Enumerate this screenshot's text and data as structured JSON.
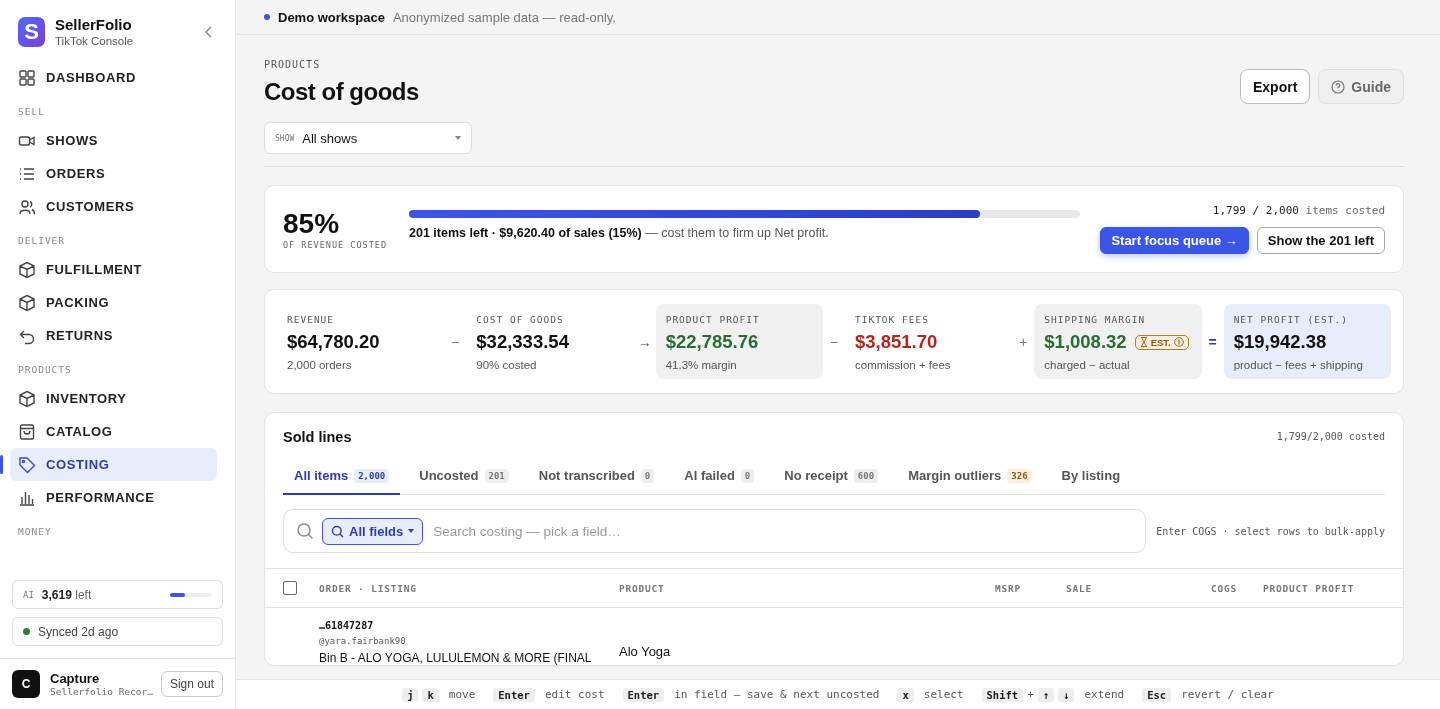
{
  "brand": {
    "name": "SellerFolio",
    "subtitle": "TikTok Console",
    "initial": "S"
  },
  "nav": [
    {
      "items": [
        {
          "label": "DASHBOARD",
          "selected": false
        }
      ]
    },
    {
      "heading": "SELL",
      "items": [
        {
          "label": "SHOWS",
          "selected": false
        },
        {
          "label": "ORDERS",
          "selected": false
        },
        {
          "label": "CUSTOMERS",
          "selected": false
        }
      ]
    },
    {
      "heading": "DELIVER",
      "items": [
        {
          "label": "FULFILLMENT",
          "selected": false
        },
        {
          "label": "PACKING",
          "selected": false
        },
        {
          "label": "RETURNS",
          "selected": false
        }
      ]
    },
    {
      "heading": "PRODUCTS",
      "items": [
        {
          "label": "INVENTORY",
          "selected": false
        },
        {
          "label": "CATALOG",
          "selected": false
        },
        {
          "label": "COSTING",
          "selected": true
        },
        {
          "label": "PERFORMANCE",
          "selected": false
        }
      ]
    },
    {
      "heading": "MONEY"
    }
  ],
  "ai_credits": {
    "prefix": "AI",
    "count": "3,619",
    "suffix": "left",
    "level": 0.35
  },
  "sync": {
    "label": "Synced 2d ago",
    "color": "#2e7d32"
  },
  "user": {
    "initial": "C",
    "name": "Capture",
    "detail": "Sellerfolio Recor…",
    "sign_out": "Sign out"
  },
  "banner": {
    "title": "Demo workspace",
    "note": "Anonymized sample data — read-only."
  },
  "page": {
    "eyebrow": "PRODUCTS",
    "title": "Cost of goods",
    "actions": [
      {
        "label": "Export",
        "kind": "primary"
      },
      {
        "label": "Guide",
        "kind": "help"
      }
    ],
    "filter": {
      "label": "SHOW",
      "value": "All shows"
    }
  },
  "coverage": {
    "percent": "85%",
    "caption": "OF REVENUE COSTED",
    "level": 0.85,
    "summary_bold": "201 items left · $9,620.40 of sales (15%)",
    "summary_rest": "— cost them to firm up Net profit.",
    "count": "1,799 / 2,000",
    "count_suffix": "items costed",
    "buttons": [
      {
        "label": "Start focus queue →",
        "kind": "primary"
      },
      {
        "label": "Show the 201 left",
        "kind": "secondary"
      }
    ]
  },
  "metrics": [
    {
      "label": "REVENUE",
      "value": "$64,780.20",
      "sub": "2,000 orders",
      "color": "#111111",
      "kind": "plain",
      "operator": "−"
    },
    {
      "label": "COST OF GOODS",
      "value": "$32,333.54",
      "sub": "90% costed",
      "color": "#111111",
      "kind": "plain",
      "operator": "→"
    },
    {
      "label": "PRODUCT PROFIT",
      "value": "$22,785.76",
      "sub": "41.3% margin",
      "color": "#2c6b34",
      "kind": "result",
      "operator": "−"
    },
    {
      "label": "TIKTOK FEES",
      "value": "$3,851.70",
      "sub": "commission + fees",
      "color": "#b3261e",
      "kind": "plain",
      "operator": "+"
    },
    {
      "label": "SHIPPING MARGIN",
      "value": "$1,008.32",
      "sub": "charged − actual",
      "color": "#2c6b34",
      "kind": "result",
      "badge": "EST.",
      "operator": "="
    },
    {
      "label": "NET PROFIT (EST.)",
      "value": "$19,942.38",
      "sub": "product − fees + shipping",
      "color": "#111111",
      "kind": "total"
    }
  ],
  "sold_lines": {
    "title": "Sold lines",
    "costed": "1,799/2,000 costed",
    "tabs": [
      {
        "label": "All items",
        "count": "2,000",
        "kind": "neutral",
        "selected": true
      },
      {
        "label": "Uncosted",
        "count": "201",
        "kind": "neutral",
        "selected": false
      },
      {
        "label": "Not transcribed",
        "count": "0",
        "kind": "neutral",
        "selected": false
      },
      {
        "label": "AI failed",
        "count": "0",
        "kind": "neutral",
        "selected": false
      },
      {
        "label": "No receipt",
        "count": "600",
        "kind": "neutral",
        "selected": false
      },
      {
        "label": "Margin outliers",
        "count": "326",
        "kind": "warning",
        "selected": false
      },
      {
        "label": "By listing",
        "selected": false
      }
    ],
    "search": {
      "scope": "All fields",
      "placeholder": "Search costing — pick a field…",
      "hint": "Enter COGS · select rows to bulk-apply"
    },
    "select_all_checked": false,
    "columns": [
      "ORDER · LISTING",
      "PRODUCT",
      "MSRP",
      "SALE",
      "COGS",
      "PRODUCT PROFIT"
    ],
    "rows": [
      {
        "order": "…61847287",
        "buyer": "@yara.fairbank90",
        "listing": "Bin B - ALO YOGA, LULULEMON & MORE (FINAL",
        "brand": "Alo Yoga"
      }
    ]
  },
  "shortcuts": [
    {
      "keys": [
        "j",
        "k"
      ],
      "label": "move"
    },
    {
      "keys": [
        "Enter"
      ],
      "label": "edit cost"
    },
    {
      "keys": [
        "Enter"
      ],
      "label": "in field — save & next uncosted"
    },
    {
      "keys": [
        "x"
      ],
      "label": "select"
    },
    {
      "keys": [
        "Shift",
        "↑",
        "↓"
      ],
      "joiner": "+",
      "label": "extend"
    },
    {
      "keys": [
        "Esc"
      ],
      "label": "revert / clear"
    }
  ]
}
